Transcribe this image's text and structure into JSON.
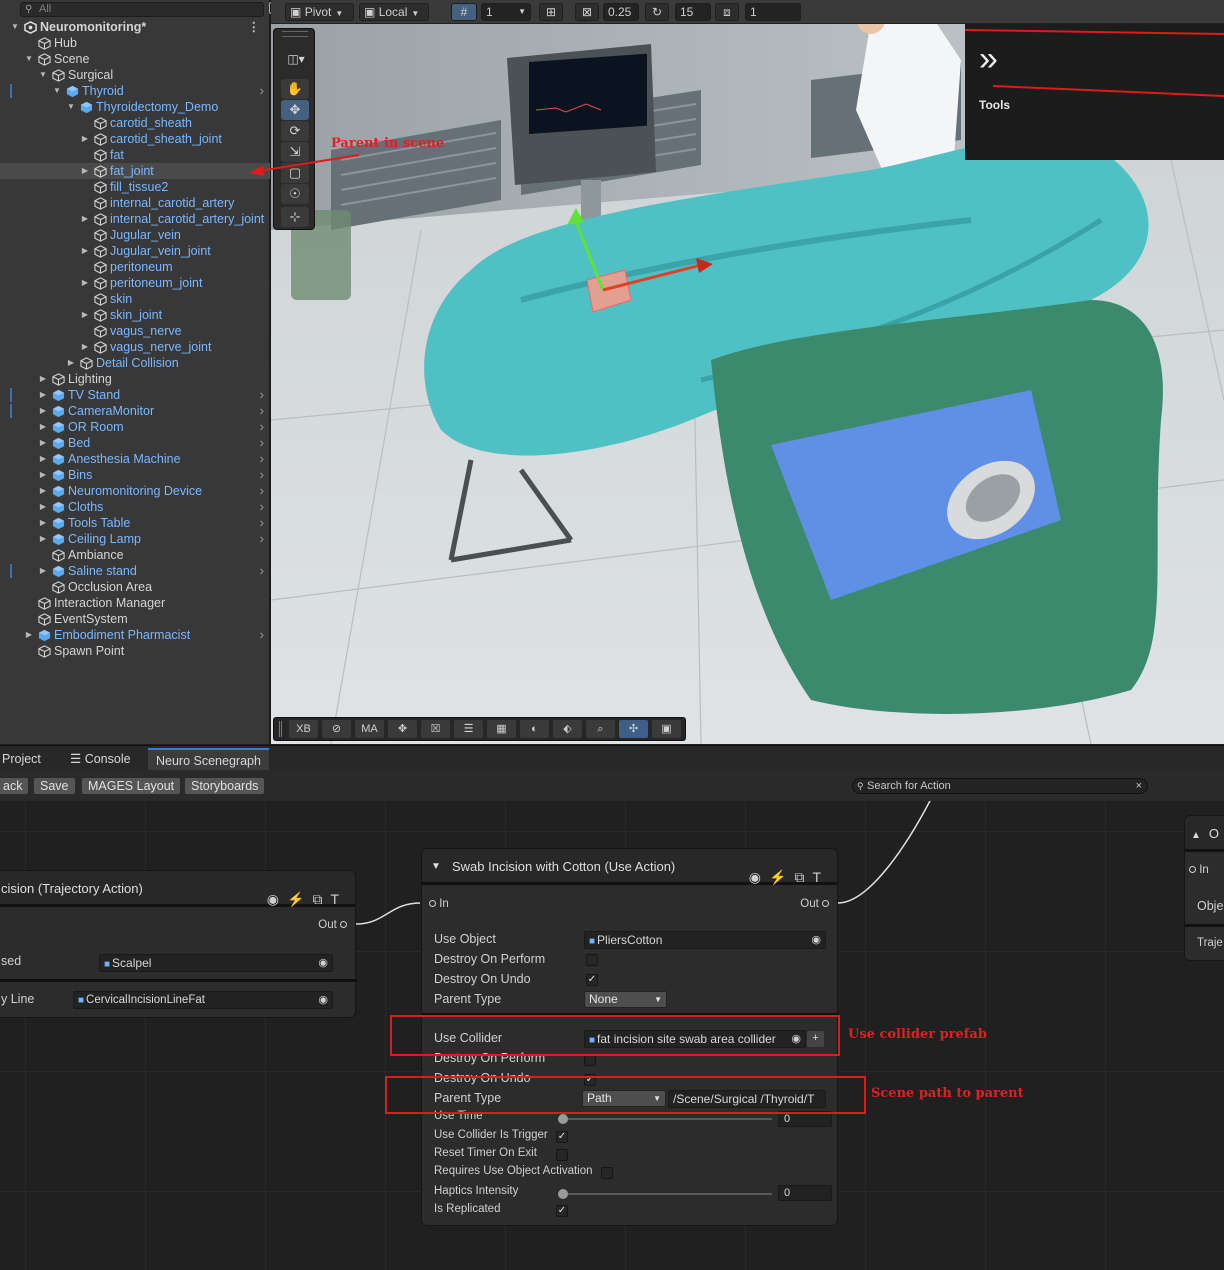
{
  "hierarchy": {
    "search_placeholder": "All",
    "rows": [
      {
        "label": "Neuromonitoring*",
        "indent": 0,
        "arrow": "down",
        "icon": "unity",
        "bold": true
      },
      {
        "label": "Hub",
        "indent": 1,
        "icon": "cube"
      },
      {
        "label": "Scene",
        "indent": 1,
        "arrow": "down",
        "icon": "cube"
      },
      {
        "label": "Surgical",
        "indent": 2,
        "arrow": "down",
        "icon": "cube"
      },
      {
        "label": "Thyroid",
        "indent": 3,
        "arrow": "down",
        "icon": "prefab",
        "blue": true,
        "chev": true,
        "marker": true
      },
      {
        "label": "Thyroidectomy_Demo",
        "indent": 4,
        "arrow": "down",
        "icon": "prefab",
        "blue": true
      },
      {
        "label": "carotid_sheath",
        "indent": 5,
        "icon": "cube",
        "blue": true
      },
      {
        "label": "carotid_sheath_joint",
        "indent": 5,
        "arrow": "right",
        "icon": "cube",
        "blue": true
      },
      {
        "label": "fat",
        "indent": 5,
        "icon": "cube",
        "blue": true
      },
      {
        "label": "fat_joint",
        "indent": 5,
        "arrow": "right",
        "icon": "cube",
        "blue": true,
        "selected": true
      },
      {
        "label": "fill_tissue2",
        "indent": 5,
        "icon": "cube",
        "blue": true
      },
      {
        "label": "internal_carotid_artery",
        "indent": 5,
        "icon": "cube",
        "blue": true
      },
      {
        "label": "internal_carotid_artery_joint",
        "indent": 5,
        "arrow": "right",
        "icon": "cube",
        "blue": true
      },
      {
        "label": "Jugular_vein",
        "indent": 5,
        "icon": "cube",
        "blue": true
      },
      {
        "label": "Jugular_vein_joint",
        "indent": 5,
        "arrow": "right",
        "icon": "cube",
        "blue": true
      },
      {
        "label": "peritoneum",
        "indent": 5,
        "icon": "cube",
        "blue": true
      },
      {
        "label": "peritoneum_joint",
        "indent": 5,
        "arrow": "right",
        "icon": "cube",
        "blue": true
      },
      {
        "label": "skin",
        "indent": 5,
        "icon": "cube",
        "blue": true
      },
      {
        "label": "skin_joint",
        "indent": 5,
        "arrow": "right",
        "icon": "cube",
        "blue": true
      },
      {
        "label": "vagus_nerve",
        "indent": 5,
        "icon": "cube",
        "blue": true
      },
      {
        "label": "vagus_nerve_joint",
        "indent": 5,
        "arrow": "right",
        "icon": "cube",
        "blue": true
      },
      {
        "label": "Detail Collision",
        "indent": 4,
        "arrow": "right",
        "icon": "cube",
        "blue": true
      },
      {
        "label": "Lighting",
        "indent": 2,
        "arrow": "right",
        "icon": "cube"
      },
      {
        "label": "TV Stand",
        "indent": 2,
        "arrow": "right",
        "icon": "prefab",
        "blue": true,
        "chev": true,
        "marker": true
      },
      {
        "label": "CameraMonitor",
        "indent": 2,
        "arrow": "right",
        "icon": "prefab",
        "blue": true,
        "chev": true,
        "marker": true
      },
      {
        "label": "OR Room",
        "indent": 2,
        "arrow": "right",
        "icon": "prefab",
        "blue": true,
        "chev": true
      },
      {
        "label": "Bed",
        "indent": 2,
        "arrow": "right",
        "icon": "prefab",
        "blue": true,
        "chev": true
      },
      {
        "label": "Anesthesia Machine",
        "indent": 2,
        "arrow": "right",
        "icon": "prefab",
        "blue": true,
        "chev": true
      },
      {
        "label": "Bins",
        "indent": 2,
        "arrow": "right",
        "icon": "prefab",
        "blue": true,
        "chev": true
      },
      {
        "label": "Neuromonitoring Device",
        "indent": 2,
        "arrow": "right",
        "icon": "prefab",
        "blue": true,
        "chev": true
      },
      {
        "label": "Cloths",
        "indent": 2,
        "arrow": "right",
        "icon": "prefab",
        "blue": true,
        "chev": true
      },
      {
        "label": "Tools Table",
        "indent": 2,
        "arrow": "right",
        "icon": "prefab",
        "blue": true,
        "chev": true
      },
      {
        "label": "Ceiling Lamp",
        "indent": 2,
        "arrow": "right",
        "icon": "prefab",
        "blue": true,
        "chev": true
      },
      {
        "label": "Ambiance",
        "indent": 2,
        "icon": "cube"
      },
      {
        "label": "Saline stand",
        "indent": 2,
        "arrow": "right",
        "icon": "prefab",
        "blue": true,
        "chev": true,
        "marker": true
      },
      {
        "label": "Occlusion Area",
        "indent": 2,
        "icon": "cube"
      },
      {
        "label": "Interaction Manager",
        "indent": 1,
        "icon": "cube"
      },
      {
        "label": "EventSystem",
        "indent": 1,
        "icon": "cube"
      },
      {
        "label": "Embodiment Pharmacist",
        "indent": 1,
        "arrow": "right",
        "icon": "prefab",
        "blue": true,
        "chev": true
      },
      {
        "label": "Spawn Point",
        "indent": 1,
        "icon": "cube"
      }
    ]
  },
  "scene_toolbar": {
    "pivot": "Pivot",
    "local": "Local",
    "grid_value": "1",
    "snap_value": "0.25",
    "angle_value": "15",
    "scale_value": "1"
  },
  "overlay_toolbar": [
    "XB",
    "",
    "MA",
    "",
    "",
    "",
    "",
    "",
    "",
    "",
    "",
    ""
  ],
  "tools_overlay": {
    "title": "Tools"
  },
  "annotations": {
    "parent_in_scene": "Parent in scene",
    "use_collider_prefab": "Use collider prefab",
    "scene_path_to_parent": "Scene path to parent"
  },
  "bottom_tabs": [
    "Project",
    "Console",
    "Neuro Scenegraph"
  ],
  "graph_toolbar": {
    "buttons": [
      "ack",
      "Save",
      "MAGES Layout",
      "Storyboards"
    ],
    "search_placeholder": "Search for Action"
  },
  "left_node": {
    "title": "cision (Trajectory Action)",
    "out": "Out",
    "props": [
      {
        "label": "sed",
        "value": "Scalpel"
      },
      {
        "label": "y Line",
        "value": "CervicalIncisionLineFat"
      }
    ]
  },
  "main_node": {
    "title": "Swab Incision with Cotton (Use Action)",
    "in": "In",
    "out": "Out",
    "use_object": {
      "label": "Use Object",
      "value": "PliersCotton"
    },
    "destroy_on_perform_1": "Destroy On Perform",
    "destroy_on_undo_1": "Destroy On Undo",
    "parent_type_1": {
      "label": "Parent Type",
      "value": "None"
    },
    "use_collider": {
      "label": "Use Collider",
      "value": "fat incision site swab area collider"
    },
    "destroy_on_perform_2": "Destroy On Perform",
    "destroy_on_undo_2": "Destroy On Undo",
    "parent_type_2": {
      "label": "Parent Type",
      "value": "Path",
      "path": "/Scene/Surgical /Thyroid/T"
    },
    "use_time": {
      "label": "Use Time",
      "value": "0"
    },
    "use_collider_is_trigger": "Use Collider Is Trigger",
    "reset_timer_on_exit": "Reset Timer On Exit",
    "requires_use_object_activation": "Requires Use Object Activation",
    "haptics_intensity": {
      "label": "Haptics Intensity",
      "value": "0"
    },
    "is_replicated": "Is Replicated"
  },
  "right_node": {
    "title": "O",
    "in": "In",
    "props": [
      "Obje",
      "Traje"
    ]
  },
  "colors": {
    "accent": "#3c7ad6",
    "prefab_blue": "#7ab8ff",
    "annotation_red": "#e01a1a",
    "bolt_orange": "#e8a228"
  }
}
